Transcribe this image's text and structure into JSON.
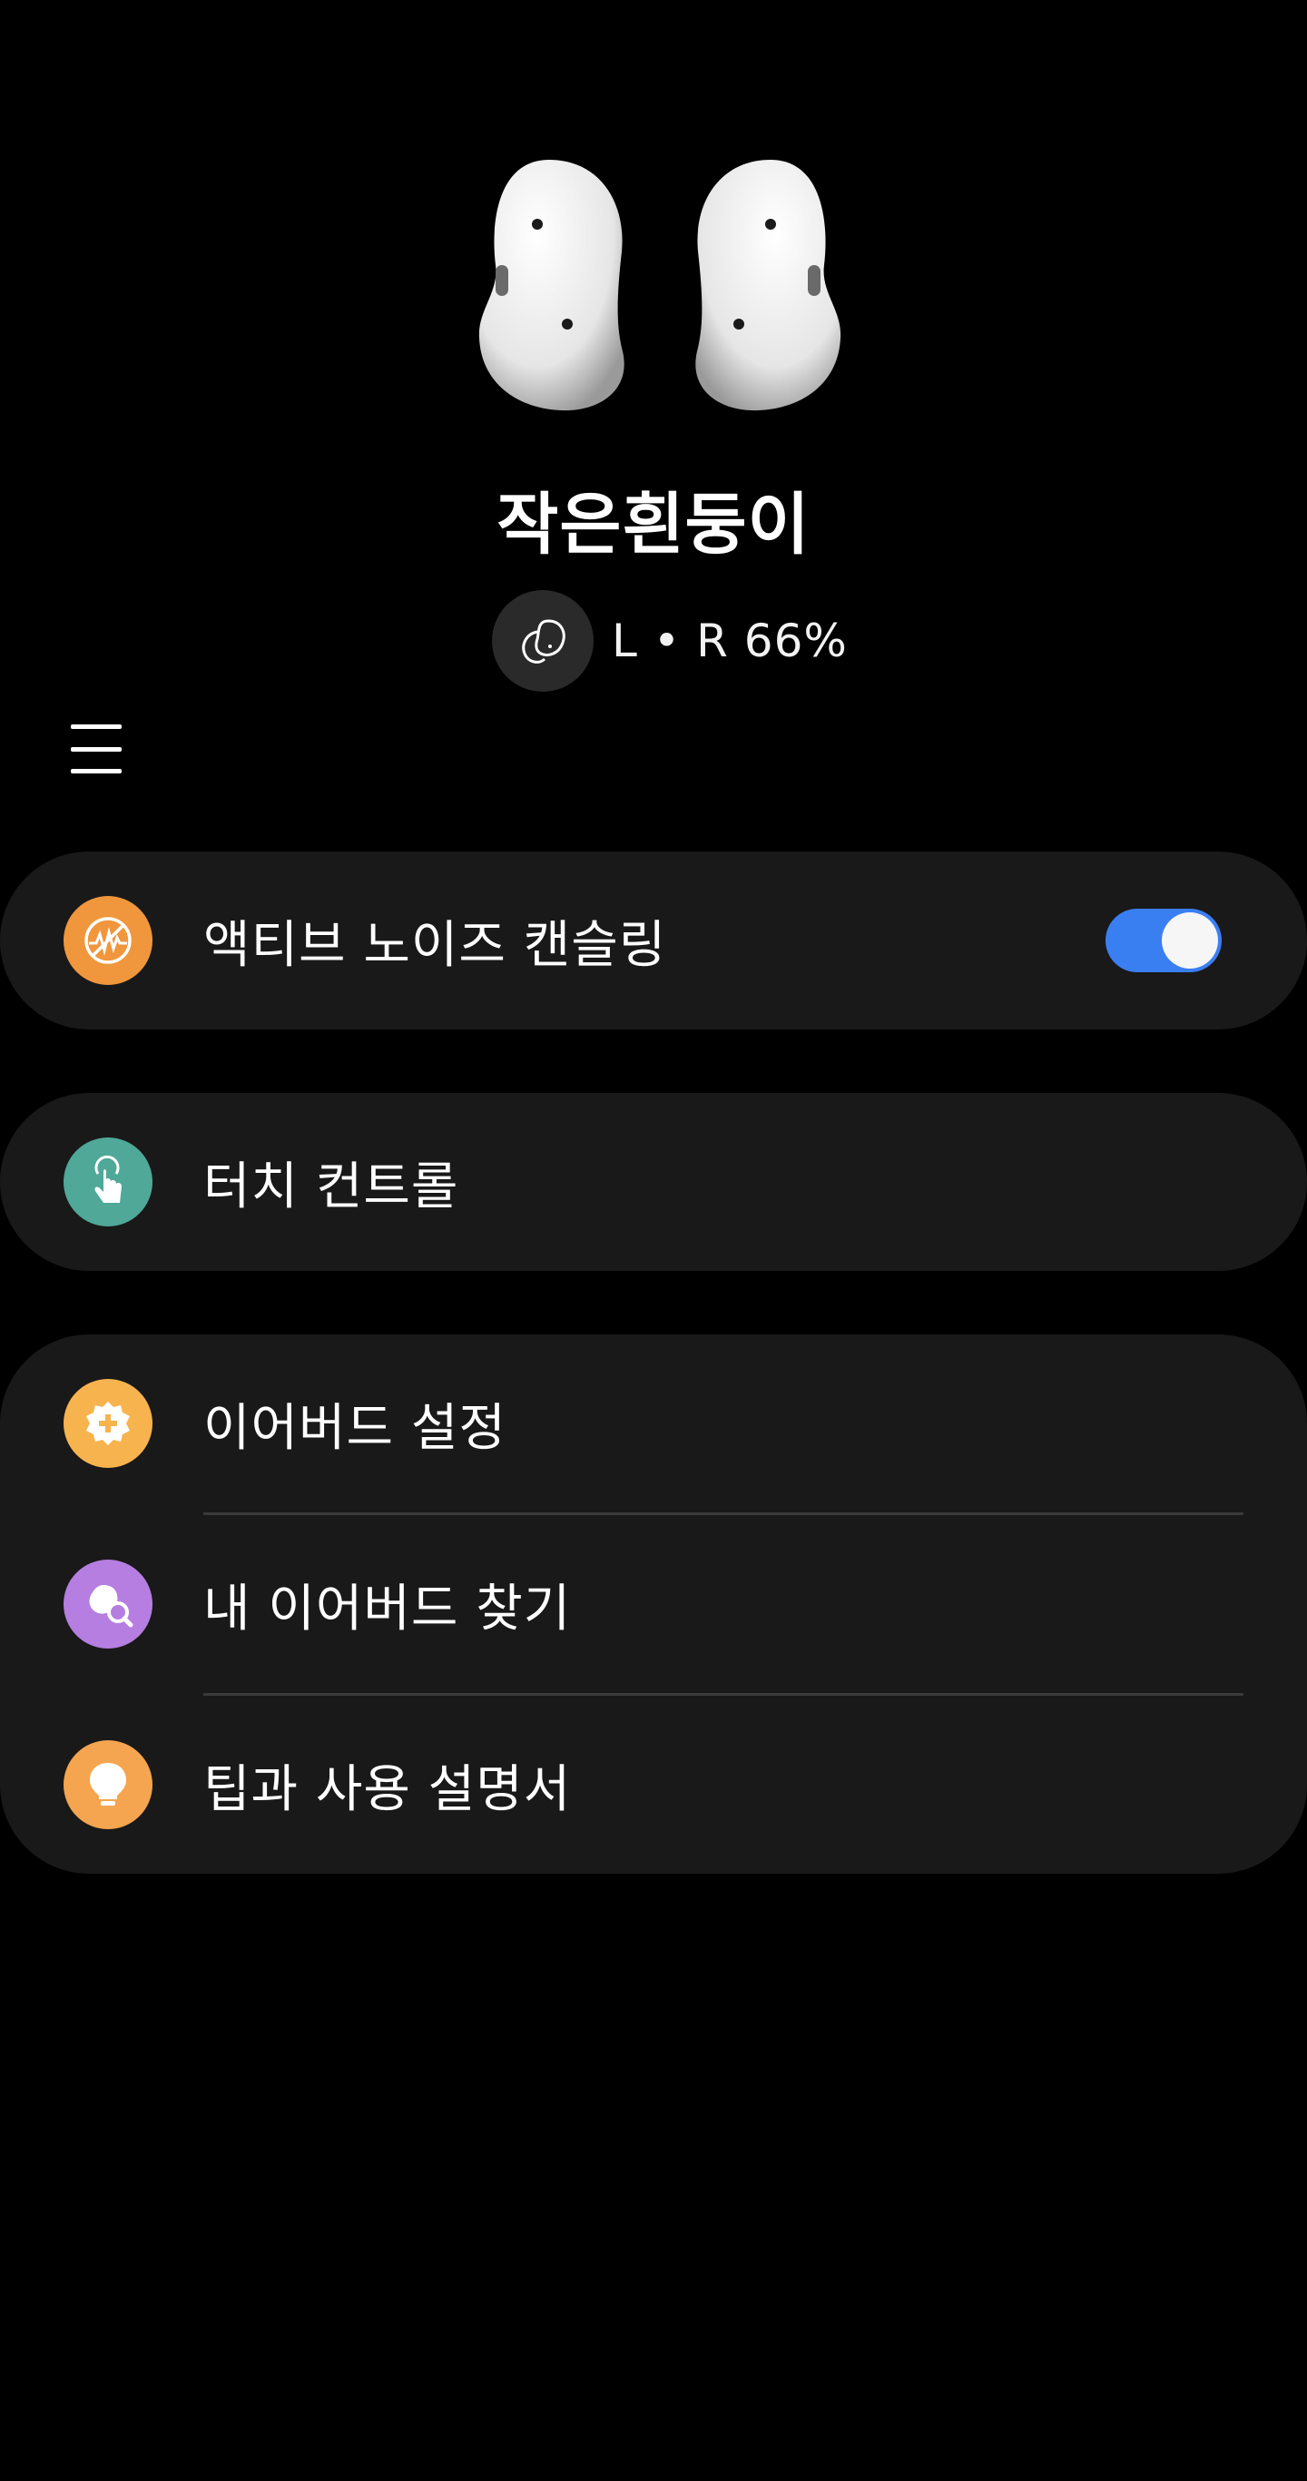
{
  "device": {
    "name": "작은흰둥이",
    "battery_label": "L • R 66%"
  },
  "features": [
    {
      "label": "액티브 노이즈 캔슬링",
      "icon": "anc-icon",
      "color": "#f0963c",
      "toggle_on": true
    },
    {
      "label": "터치 컨트롤",
      "icon": "touch-icon",
      "color": "#4fa898"
    }
  ],
  "settings": [
    {
      "label": "이어버드 설정",
      "icon": "gear-icon",
      "color": "#f7b34e"
    },
    {
      "label": "내 이어버드 찾기",
      "icon": "find-icon",
      "color": "#b57ee0"
    },
    {
      "label": "팁과 사용 설명서",
      "icon": "bulb-icon",
      "color": "#f5a54f"
    }
  ],
  "colors": {
    "background": "#000000",
    "card": "#191919",
    "toggle_on": "#3a7ff2"
  }
}
